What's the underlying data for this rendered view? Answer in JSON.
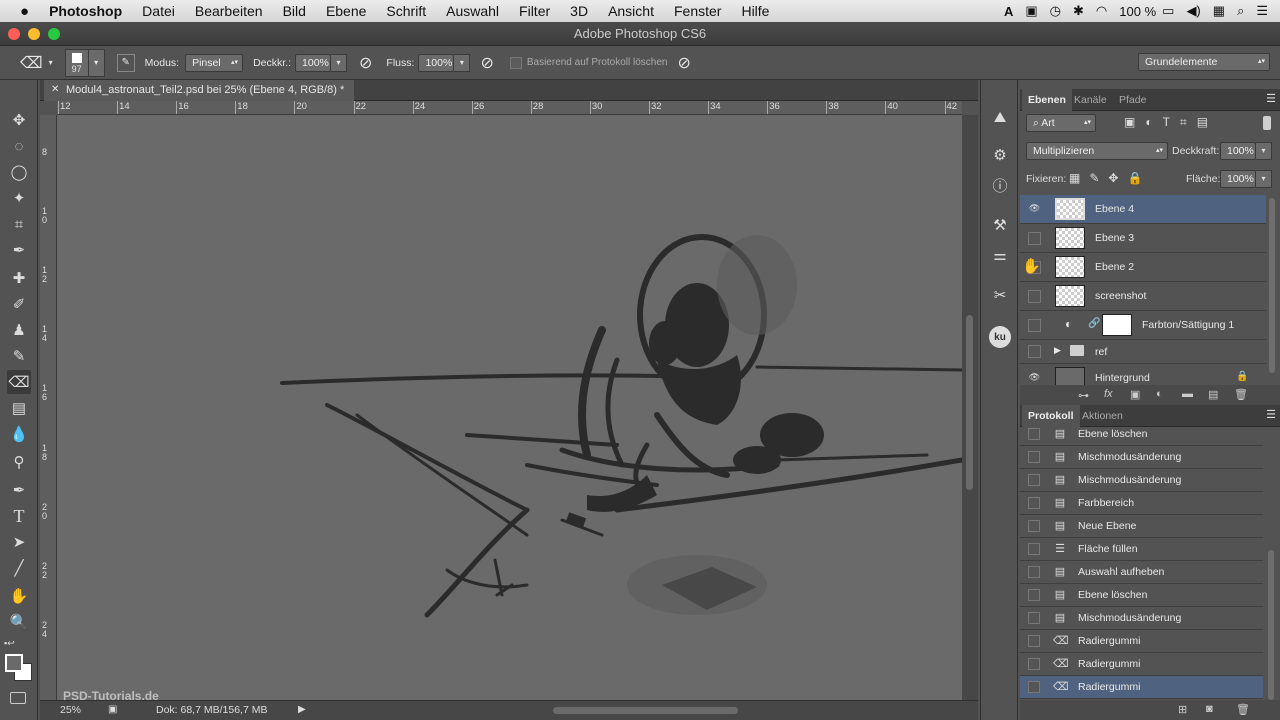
{
  "menubar": {
    "apple": "",
    "app_name": "Photoshop",
    "items": [
      "Datei",
      "Bearbeiten",
      "Bild",
      "Ebene",
      "Schrift",
      "Auswahl",
      "Filter",
      "3D",
      "Ansicht",
      "Fenster",
      "Hilfe"
    ],
    "battery": "100 %"
  },
  "window": {
    "title": "Adobe Photoshop CS6"
  },
  "options": {
    "brush_size": "97",
    "mode_label": "Modus:",
    "mode_value": "Pinsel",
    "opacity_label": "Deckkr.:",
    "opacity_value": "100%",
    "flow_label": "Fluss:",
    "flow_value": "100%",
    "erase_history_label": "Basierend auf Protokoll löschen",
    "workspace": "Grundelemente"
  },
  "document": {
    "tab_title": "Modul4_astronaut_Teil2.psd bei 25% (Ebene 4, RGB/8) *",
    "ruler_top": [
      "12",
      "14",
      "16",
      "18",
      "20",
      "22",
      "24",
      "26",
      "28",
      "30",
      "32",
      "34",
      "36",
      "38",
      "40",
      "42"
    ],
    "ruler_left": [
      "8",
      "1\n0",
      "1\n2",
      "1\n4",
      "1\n6",
      "1\n8",
      "2\n0",
      "2\n2",
      "2\n4"
    ]
  },
  "status": {
    "zoom": "25%",
    "doc": "Dok: 68,7 MB/156,7 MB"
  },
  "watermark": "PSD-Tutorials.de",
  "layers_panel": {
    "tabs": [
      "Ebenen",
      "Kanäle",
      "Pfade"
    ],
    "filter_label": "Art",
    "blend_mode": "Multiplizieren",
    "opacity_label": "Deckkraft:",
    "opacity_value": "100%",
    "lock_label": "Fixieren:",
    "fill_label": "Fläche:",
    "fill_value": "100%",
    "layers": [
      {
        "name": "Ebene 4",
        "visible": true,
        "selected": true
      },
      {
        "name": "Ebene 3",
        "visible": false,
        "selected": false
      },
      {
        "name": "Ebene 2",
        "visible": false,
        "selected": false
      },
      {
        "name": "screenshot",
        "visible": false,
        "selected": false
      },
      {
        "name": "Farbton/Sättigung 1",
        "visible": false,
        "selected": false
      },
      {
        "name": "ref",
        "visible": false,
        "selected": false
      },
      {
        "name": "Hintergrund",
        "visible": true,
        "selected": false
      }
    ]
  },
  "history_panel": {
    "tabs": [
      "Protokoll",
      "Aktionen"
    ],
    "items": [
      "Ebene löschen",
      "Mischmodusänderung",
      "Mischmodusänderung",
      "Farbbereich",
      "Neue Ebene",
      "Fläche füllen",
      "Auswahl aufheben",
      "Ebene löschen",
      "Mischmodusänderung",
      "Radiergummi",
      "Radiergummi",
      "Radiergummi"
    ],
    "selected_index": 11
  },
  "colors": {
    "panel_bg": "#535353",
    "canvas_bg": "#6a6a6a",
    "selection": "#4f6280",
    "ink": "#2b2b2b"
  }
}
